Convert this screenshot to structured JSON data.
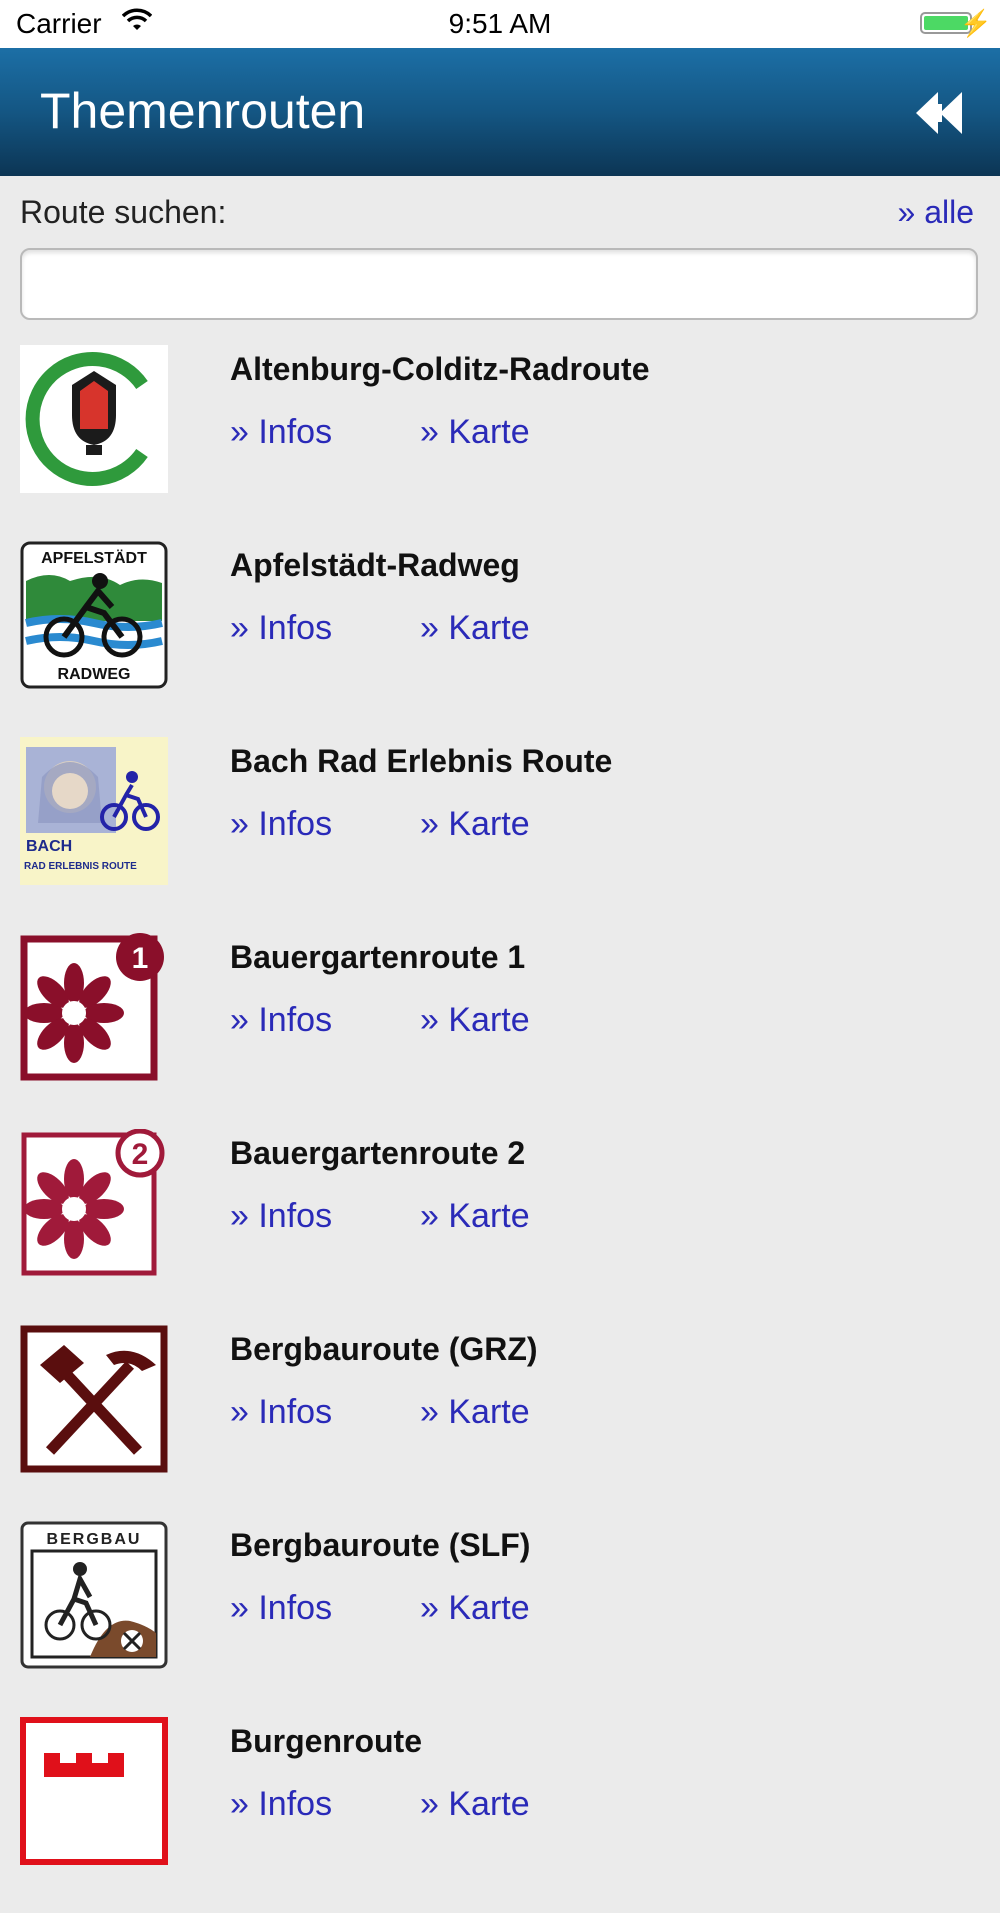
{
  "status_bar": {
    "carrier": "Carrier",
    "time": "9:51 AM",
    "battery_level": 1.0
  },
  "header": {
    "title": "Themenrouten",
    "back_icon": "double-chevron-left-icon"
  },
  "search": {
    "label": "Route suchen:",
    "all_link": "» alle",
    "value": "",
    "placeholder": ""
  },
  "colors": {
    "header_top": "#1c6fa6",
    "header_bottom": "#0c3554",
    "link": "#2a2ab8",
    "background": "#ebebeb"
  },
  "routes": [
    {
      "name": "Altenburg-Colditz-Radroute",
      "infos": "» Infos",
      "karte": "» Karte",
      "logo": "altenburg-colditz-logo"
    },
    {
      "name": "Apfelstädt-Radweg",
      "infos": "» Infos",
      "karte": "» Karte",
      "logo": "apfelstaedt-radweg-logo",
      "logo_top": "APFELSTÄDT",
      "logo_bottom": "RADWEG"
    },
    {
      "name": "Bach Rad Erlebnis Route",
      "infos": "» Infos",
      "karte": "» Karte",
      "logo": "bach-rad-logo",
      "logo_top": "BACH",
      "logo_bottom": "RAD ERLEBNIS ROUTE"
    },
    {
      "name": "Bauergartenroute 1",
      "infos": "» Infos",
      "karte": "» Karte",
      "logo": "bauergarten-1-logo",
      "logo_badge": "1"
    },
    {
      "name": "Bauergartenroute 2",
      "infos": "» Infos",
      "karte": "» Karte",
      "logo": "bauergarten-2-logo",
      "logo_badge": "2"
    },
    {
      "name": "Bergbauroute (GRZ)",
      "infos": "» Infos",
      "karte": "» Karte",
      "logo": "bergbau-grz-logo"
    },
    {
      "name": "Bergbauroute (SLF)",
      "infos": "» Infos",
      "karte": "» Karte",
      "logo": "bergbau-slf-logo",
      "logo_top": "BERGBAU"
    },
    {
      "name": "Burgenroute",
      "infos": "» Infos",
      "karte": "» Karte",
      "logo": "burgenroute-logo"
    }
  ]
}
